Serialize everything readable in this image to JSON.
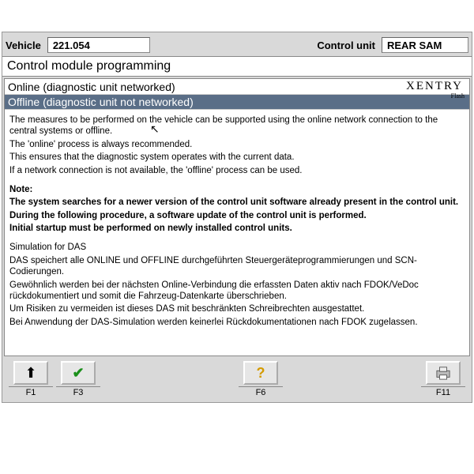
{
  "header": {
    "vehicle_label": "Vehicle",
    "vehicle_value": "221.054",
    "cu_label": "Control unit",
    "cu_value": "REAR SAM"
  },
  "title": "Control module programming",
  "options": {
    "online": "Online (diagnostic unit networked)",
    "offline": "Offline (diagnostic unit not networked)",
    "brand": "XENTRY",
    "brand_sub": "Flash"
  },
  "body": {
    "p1": "The measures to be performed on the vehicle can be supported using the online network connection to the central systems or offline.",
    "p2": "The 'online' process is always recommended.",
    "p3": "This ensures that the diagnostic system operates with the current data.",
    "p4": "If a network connection is not available, the 'offline' process can be used.",
    "note_h": "Note:",
    "note1": "The system searches for a newer version of the control unit software already present in the control unit.",
    "note2": "During the following procedure, a software update of the control unit is performed.",
    "note3": "Initial startup must be performed on newly installed control units.",
    "sim_h": "Simulation for DAS",
    "sim1": "DAS speichert alle ONLINE und OFFLINE durchgeführten Steuergeräteprogrammierungen und SCN-Codierungen.",
    "sim2": "Gewöhnlich werden bei der nächsten Online-Verbindung die erfassten Daten aktiv nach FDOK/VeDoc rückdokumentiert und somit die Fahrzeug-Datenkarte überschrieben.",
    "sim3": "Um Risiken zu vermeiden ist dieses DAS mit beschränkten Schreibrechten ausgestattet.",
    "sim4": "Bei Anwendung der DAS-Simulation werden keinerlei Rückdokumentationen nach FDOK zugelassen."
  },
  "footer": {
    "f1": "F1",
    "f3": "F3",
    "f6": "F6",
    "f11": "F11"
  }
}
